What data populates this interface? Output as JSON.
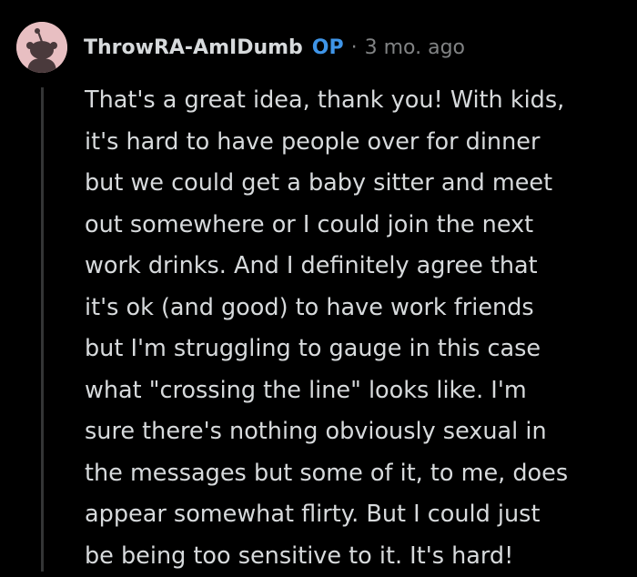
{
  "comment": {
    "author": "ThrowRA-AmIDumb",
    "badge": "OP",
    "separator": "·",
    "timestamp": "3 mo. ago",
    "avatar_icon": "snoo-avatar-icon",
    "body": "That's a great idea, thank you! With kids,\nit's hard to have people over for dinner\nbut we could get a baby sitter and meet\nout somewhere or I could join the next\nwork drinks. And I definitely agree that\nit's ok (and good) to have work friends\nbut I'm struggling to gauge in this case\nwhat \"crossing the line\" looks like. I'm\nsure there's nothing obviously sexual in\nthe messages but some of it, to me, does\nappear somewhat flirty. But I could just\nbe being too sensitive to it. It's hard!"
  },
  "colors": {
    "background": "#000000",
    "text": "#d7dadc",
    "meta": "#818384",
    "op_badge": "#3f95e8",
    "avatar_bg": "#e8bfc2",
    "avatar_figure": "#4a3a3c",
    "thread_line": "#343536"
  }
}
